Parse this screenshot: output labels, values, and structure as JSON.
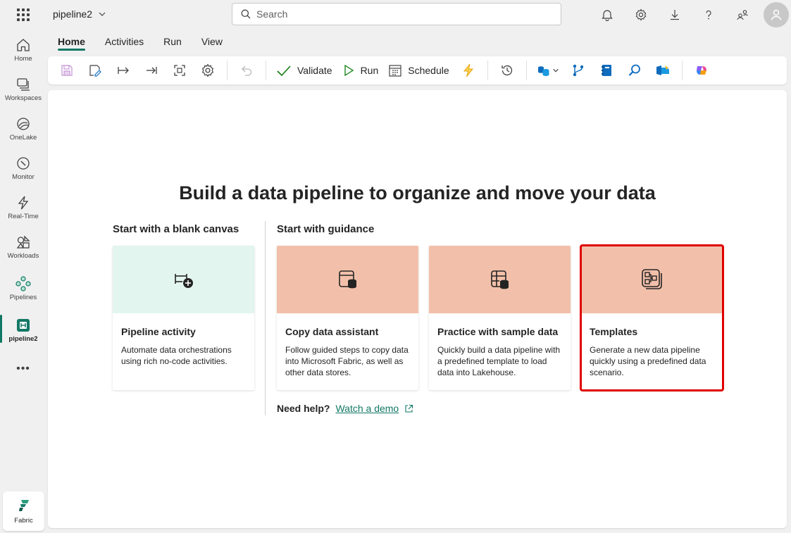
{
  "topbar": {
    "app_name": "pipeline2",
    "search_placeholder": "Search"
  },
  "rail": {
    "items": [
      {
        "label": "Home",
        "icon": "home-icon"
      },
      {
        "label": "Workspaces",
        "icon": "workspaces-icon"
      },
      {
        "label": "OneLake",
        "icon": "onelake-icon"
      },
      {
        "label": "Monitor",
        "icon": "monitor-icon"
      },
      {
        "label": "Real-Time",
        "icon": "realtime-icon"
      },
      {
        "label": "Workloads",
        "icon": "workloads-icon"
      },
      {
        "label": "Pipelines",
        "icon": "pipelines-icon"
      },
      {
        "label": "pipeline2",
        "icon": "pipeline-item-icon"
      }
    ],
    "more": "•••",
    "fabric_label": "Fabric"
  },
  "tabs": [
    {
      "label": "Home",
      "active": true
    },
    {
      "label": "Activities",
      "active": false
    },
    {
      "label": "Run",
      "active": false
    },
    {
      "label": "View",
      "active": false
    }
  ],
  "toolbar": {
    "validate_label": "Validate",
    "run_label": "Run",
    "schedule_label": "Schedule"
  },
  "main": {
    "headline": "Build a data pipeline to organize and move your data",
    "blank_section": "Start with a blank canvas",
    "guidance_section": "Start with guidance",
    "cards": [
      {
        "title": "Pipeline activity",
        "description": "Automate data orchestrations using rich no-code activities."
      },
      {
        "title": "Copy data assistant",
        "description": "Follow guided steps to copy data into Microsoft Fabric, as well as other data stores."
      },
      {
        "title": "Practice with sample data",
        "description": "Quickly build a data pipeline with a predefined template to load data into Lakehouse."
      },
      {
        "title": "Templates",
        "description": "Generate a new data pipeline quickly using a predefined data scenario."
      }
    ],
    "help_question": "Need help?",
    "help_link": "Watch a demo"
  },
  "colors": {
    "accent": "#117865",
    "card_green": "#e3f5ef",
    "card_salmon": "#f2c0aa",
    "highlight": "#e00000"
  }
}
